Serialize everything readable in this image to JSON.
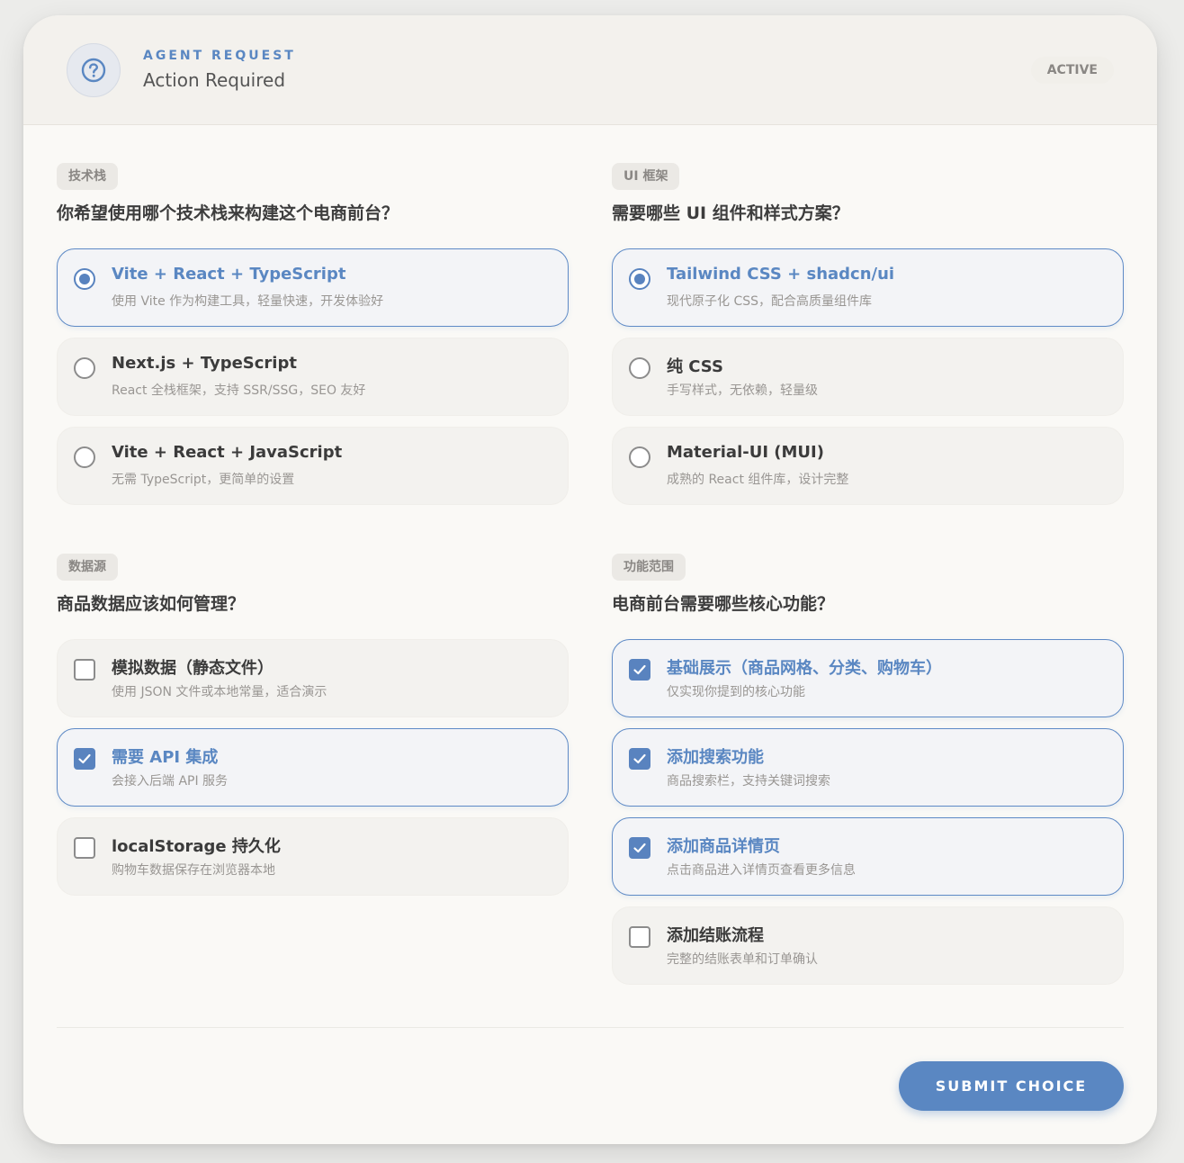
{
  "header": {
    "eyebrow": "AGENT REQUEST",
    "title": "Action Required",
    "status": "ACTIVE",
    "icon": "question-circle-icon",
    "accent_color": "#5a87c2"
  },
  "sections": [
    {
      "tag": "技术栈",
      "question": "你希望使用哪个技术栈来构建这个电商前台？",
      "type": "radio",
      "options": [
        {
          "title": "Vite + React + TypeScript",
          "desc": "使用 Vite 作为构建工具，轻量快速，开发体验好",
          "selected": true
        },
        {
          "title": "Next.js + TypeScript",
          "desc": "React 全栈框架，支持 SSR/SSG，SEO 友好",
          "selected": false
        },
        {
          "title": "Vite + React + JavaScript",
          "desc": "无需 TypeScript，更简单的设置",
          "selected": false
        }
      ]
    },
    {
      "tag": "UI 框架",
      "question": "需要哪些 UI 组件和样式方案？",
      "type": "radio",
      "options": [
        {
          "title": "Tailwind CSS + shadcn/ui",
          "desc": "现代原子化 CSS，配合高质量组件库",
          "selected": true
        },
        {
          "title": "纯 CSS",
          "desc": "手写样式，无依赖，轻量级",
          "selected": false
        },
        {
          "title": "Material-UI (MUI)",
          "desc": "成熟的 React 组件库，设计完整",
          "selected": false
        }
      ]
    },
    {
      "tag": "数据源",
      "question": "商品数据应该如何管理？",
      "type": "checkbox",
      "options": [
        {
          "title": "模拟数据（静态文件）",
          "desc": "使用 JSON 文件或本地常量，适合演示",
          "selected": false
        },
        {
          "title": "需要 API 集成",
          "desc": "会接入后端 API 服务",
          "selected": true
        },
        {
          "title": "localStorage 持久化",
          "desc": "购物车数据保存在浏览器本地",
          "selected": false
        }
      ]
    },
    {
      "tag": "功能范围",
      "question": "电商前台需要哪些核心功能？",
      "type": "checkbox",
      "options": [
        {
          "title": "基础展示（商品网格、分类、购物车）",
          "desc": "仅实现你提到的核心功能",
          "selected": true
        },
        {
          "title": "添加搜索功能",
          "desc": "商品搜索栏，支持关键词搜索",
          "selected": true
        },
        {
          "title": "添加商品详情页",
          "desc": "点击商品进入详情页查看更多信息",
          "selected": true
        },
        {
          "title": "添加结账流程",
          "desc": "完整的结账表单和订单确认",
          "selected": false
        }
      ]
    }
  ],
  "submit_label": "SUBMIT CHOICE"
}
